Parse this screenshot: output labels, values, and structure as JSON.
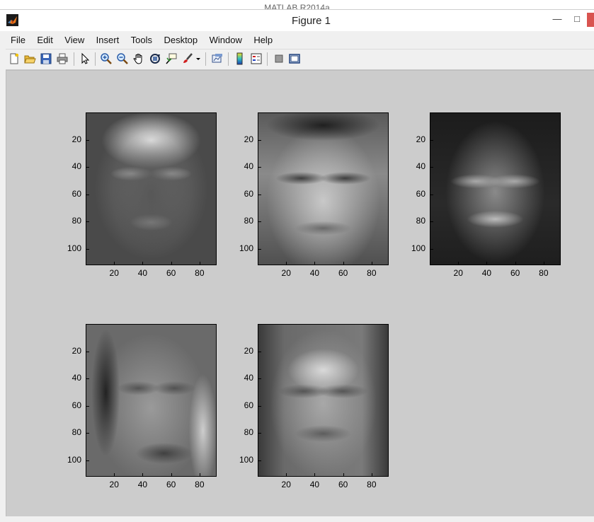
{
  "background_window_title": "MATLAB R2014a",
  "window": {
    "title": "Figure 1",
    "minimize_label": "—",
    "maximize_label": "□",
    "close_label": ""
  },
  "menu": [
    "File",
    "Edit",
    "View",
    "Insert",
    "Tools",
    "Desktop",
    "Window",
    "Help"
  ],
  "toolbar_icons": [
    "new-figure-icon",
    "open-file-icon",
    "save-icon",
    "print-icon",
    "edit-plot-arrow-icon",
    "zoom-in-icon",
    "zoom-out-icon",
    "pan-hand-icon",
    "rotate-3d-icon",
    "data-cursor-icon",
    "brush-icon",
    "brush-dropdown-icon",
    "link-plot-icon",
    "insert-colorbar-icon",
    "insert-legend-icon",
    "hide-plot-tools-icon",
    "show-plot-tools-icon"
  ],
  "subplots": [
    {
      "name": "subplot-1",
      "yticks": [
        "20",
        "40",
        "60",
        "80",
        "100"
      ],
      "xticks": [
        "20",
        "40",
        "60",
        "80"
      ],
      "shade": "light-bg"
    },
    {
      "name": "subplot-2",
      "yticks": [
        "20",
        "40",
        "60",
        "80",
        "100"
      ],
      "xticks": [
        "20",
        "40",
        "60",
        "80"
      ],
      "shade": "dark-hair"
    },
    {
      "name": "subplot-3",
      "yticks": [
        "20",
        "40",
        "60",
        "80",
        "100"
      ],
      "xticks": [
        "20",
        "40",
        "60",
        "80"
      ],
      "shade": "dark-bg"
    },
    {
      "name": "subplot-4",
      "yticks": [
        "20",
        "40",
        "60",
        "80",
        "100"
      ],
      "xticks": [
        "20",
        "40",
        "60",
        "80"
      ],
      "shade": "mid"
    },
    {
      "name": "subplot-5",
      "yticks": [
        "20",
        "40",
        "60",
        "80",
        "100"
      ],
      "xticks": [
        "20",
        "40",
        "60",
        "80"
      ],
      "shade": "textured"
    }
  ],
  "colors": {
    "figure_bg": "#cccccc",
    "window_bg": "#f0f0f0",
    "close_button": "#d9534f"
  }
}
